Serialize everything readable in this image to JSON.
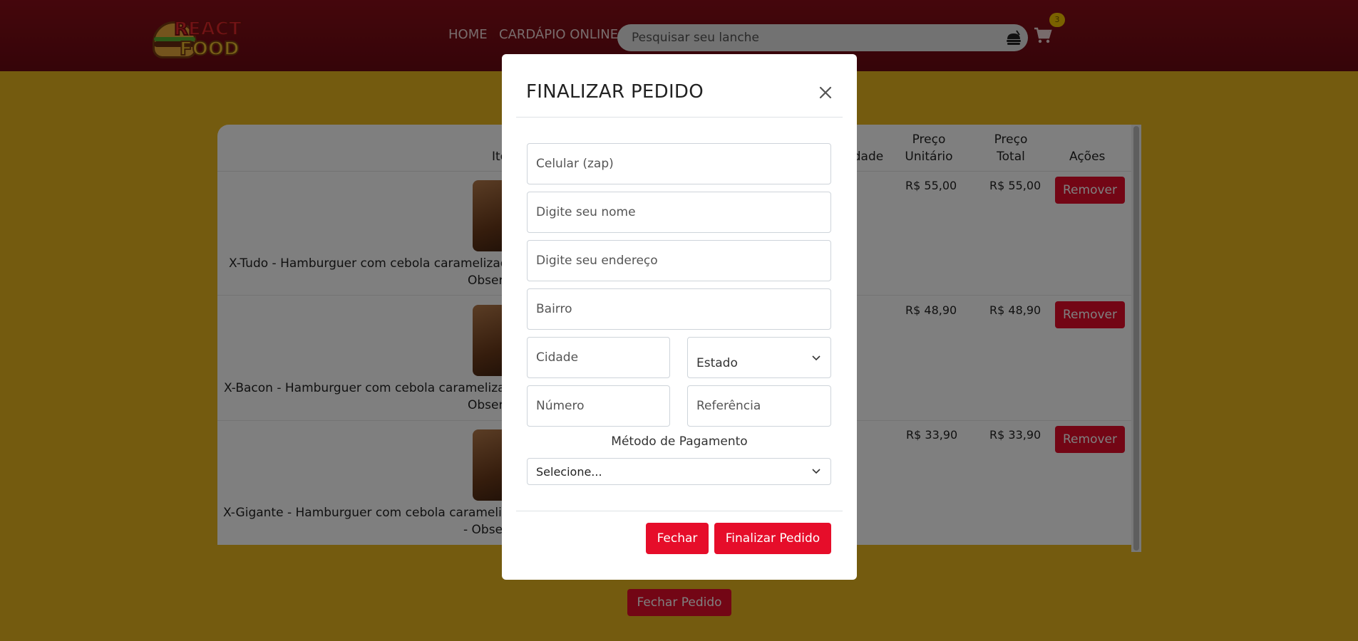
{
  "header": {
    "logo_line1": "REACT",
    "logo_line2": "FOOD",
    "nav_home": "HOME",
    "nav_menu": "CARDÁPIO ONLINE",
    "search_placeholder": "Pesquisar seu lanche",
    "cart_count": "3"
  },
  "table": {
    "headers": {
      "item": "Item",
      "quantity": "Quantidade",
      "unit_price": "Preço Unitário",
      "total_price": "Preço Total",
      "actions": "Ações"
    },
    "rows": [
      {
        "name": "X-Tudo - Hamburguer com cebola caramelizada",
        "obs": "Obser",
        "unit": "R$ 55,00",
        "total": "R$ 55,00",
        "action": "Remover"
      },
      {
        "name": "X-Bacon - Hamburguer com cebola carameliza",
        "obs": "Obser",
        "unit": "R$ 48,90",
        "total": "R$ 48,90",
        "action": "Remover"
      },
      {
        "name": "X-Gigante - Hamburguer com cebola caramelizad",
        "obs": "- Obse",
        "unit": "R$ 33,90",
        "total": "R$ 33,90",
        "action": "Remover"
      }
    ],
    "close_order_button": "Fechar Pedido"
  },
  "modal": {
    "title": "FINALIZAR PEDIDO",
    "fields": {
      "phone": "Celular (zap)",
      "name": "Digite seu nome",
      "address": "Digite seu endereço",
      "district": "Bairro",
      "city": "Cidade",
      "state": "Estado",
      "number": "Número",
      "reference": "Referência"
    },
    "payment_label": "Método de Pagamento",
    "payment_selected": "Selecione...",
    "close_button": "Fechar",
    "submit_button": "Finalizar Pedido"
  },
  "colors": {
    "header": "#7a0c15",
    "background": "#e8b71f",
    "accent_button": "#e60d2a"
  }
}
